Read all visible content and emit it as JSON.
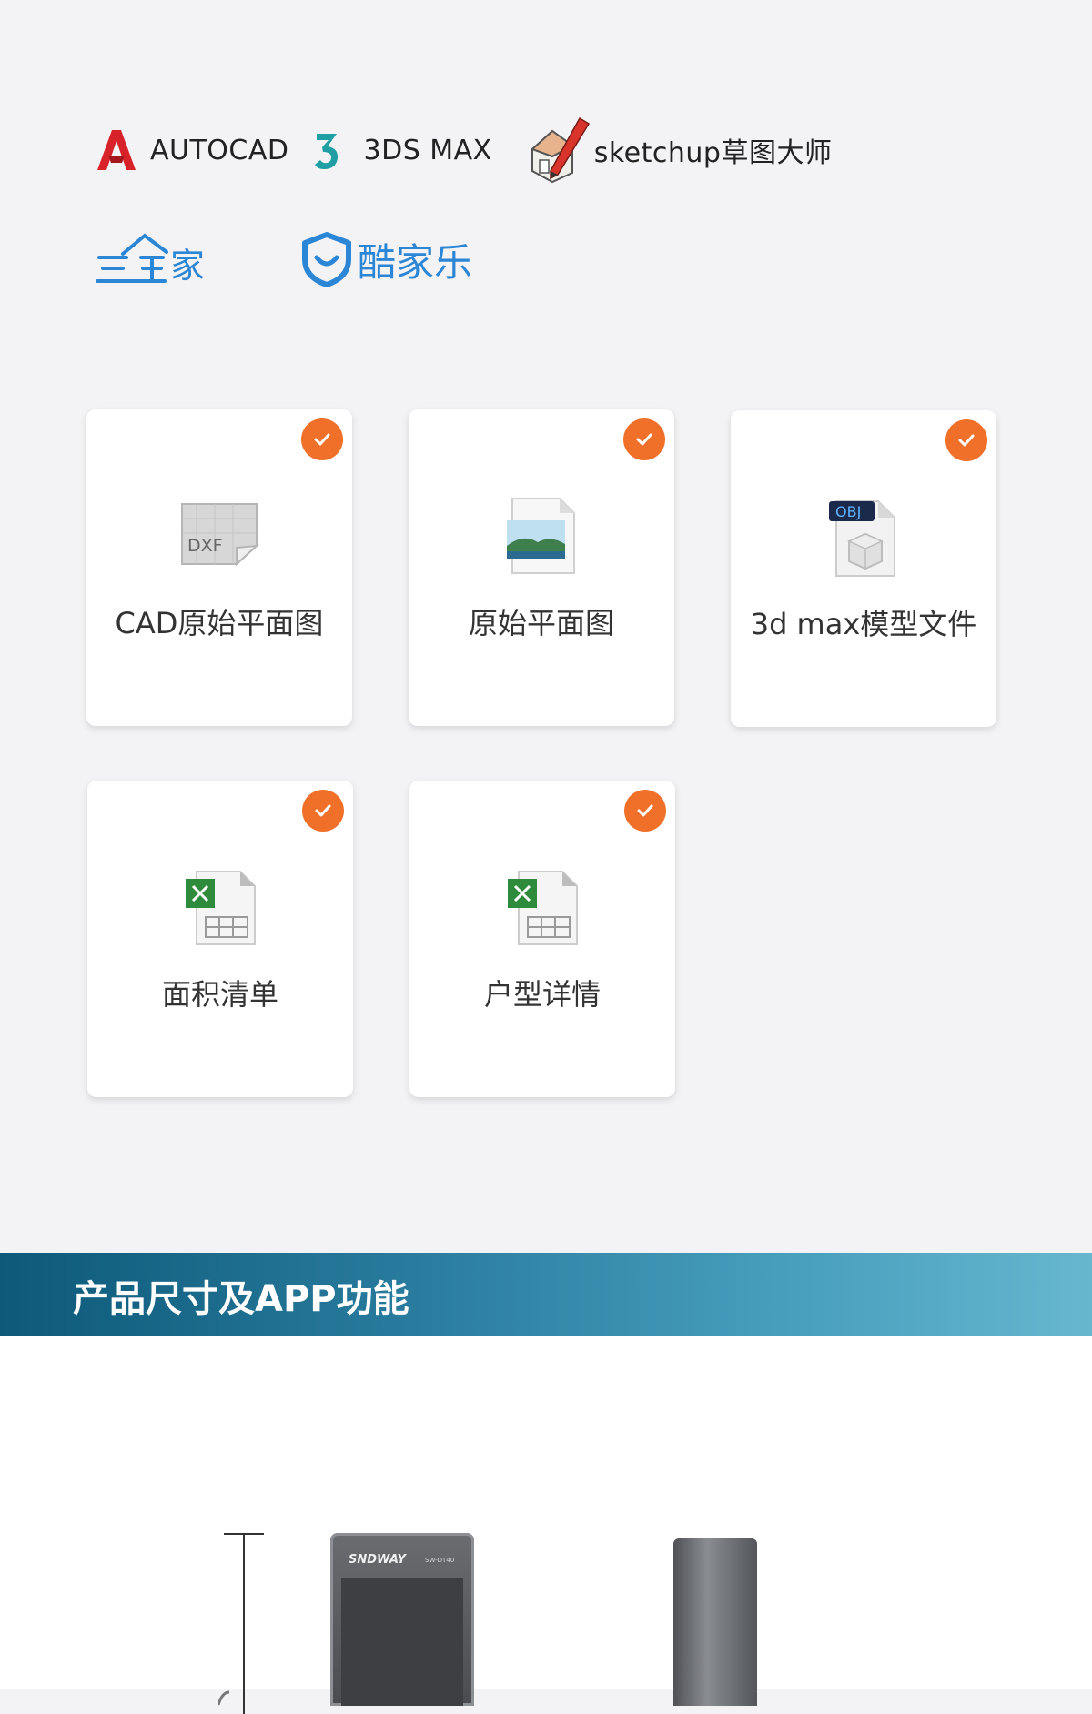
{
  "logos": {
    "autocad": "AUTOCAD",
    "threedsmax": "3DS MAX",
    "sketchup": "sketchup草图大师",
    "sanweijia": "三维家",
    "kujiale": "酷家乐"
  },
  "cards": [
    {
      "label": "CAD原始平面图",
      "icon": "dxf-file-icon"
    },
    {
      "label": "原始平面图",
      "icon": "image-file-icon"
    },
    {
      "label": "3d max模型文件",
      "icon": "obj-file-icon"
    },
    {
      "label": "面积清单",
      "icon": "excel-file-icon"
    },
    {
      "label": "户型详情",
      "icon": "excel-file-icon"
    }
  ],
  "section": {
    "title": "产品尺寸及APP功能"
  },
  "product": {
    "brand": "SNDWAY",
    "model": "SW-DT40"
  },
  "colors": {
    "accent_orange": "#f0702a",
    "brand_blue": "#2c86d6",
    "banner_dark": "#0d5979",
    "banner_light": "#67b7cf"
  }
}
